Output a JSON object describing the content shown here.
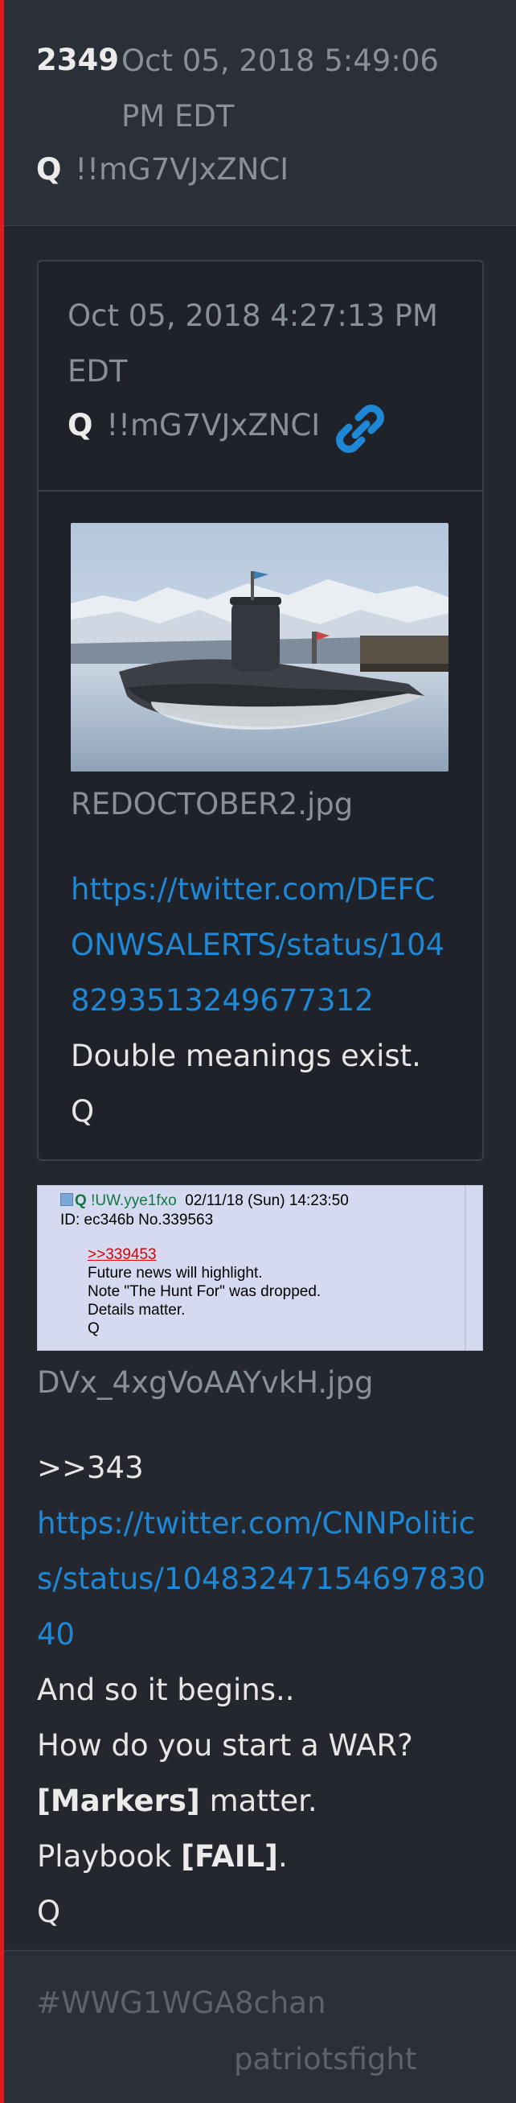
{
  "header": {
    "post_number": "2349",
    "date": "Oct 05, 2018 5:49:06 PM EDT",
    "q_label": "Q",
    "tripcode": "!!mG7VJxZNCI"
  },
  "quoted_post": {
    "date": "Oct 05, 2018 4:27:13 PM EDT",
    "q_label": "Q",
    "tripcode": "!!mG7VJxZNCI",
    "image_filename": "REDOCTOBER2.jpg",
    "link": "https://twitter.com/DEFCONWSALERTS/status/1048293513249677312",
    "lines": [
      "Double meanings exist.",
      "Q"
    ]
  },
  "quote_image": {
    "name": "Q",
    "trip": "!UW.yye1fxo",
    "date": "02/11/18 (Sun) 14:23:50",
    "id_line": "ID: ec346b No.339563",
    "reply_link": ">>339453",
    "lines": [
      "Future news will highlight.",
      "Note \"The Hunt For\" was dropped.",
      "Details matter.",
      "Q"
    ],
    "filename": "DVx_4xgVoAAYvkH.jpg"
  },
  "main_post": {
    "reply_ref": ">>343",
    "link": "https://twitter.com/CNNPolitics/status/1048324715469783040",
    "line_begin": "And so it begins..",
    "line_war": "How do you start a WAR?",
    "markers_bold": "[Markers]",
    "markers_rest": " matter.",
    "playbook_pre": "Playbook ",
    "playbook_bold": "[FAIL]",
    "playbook_post": ".",
    "signature": "Q"
  },
  "footer": {
    "tag1": "#WWG1WGA8chan",
    "tag2": "patriotsfight"
  },
  "colors": {
    "accent_red": "#e21c1c",
    "link_blue": "#1e88d6",
    "background": "#292d36"
  },
  "icons": [
    "link-icon"
  ]
}
